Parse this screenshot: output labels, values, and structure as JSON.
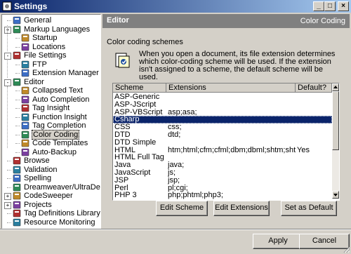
{
  "window": {
    "title": "Settings",
    "controls": [
      "minimize",
      "maximize",
      "close"
    ]
  },
  "tree": {
    "items": [
      {
        "label": "General",
        "icon": "general-icon",
        "expander": ""
      },
      {
        "label": "Markup Languages",
        "icon": "markup-icon",
        "expander": "+"
      },
      {
        "label": "Startup",
        "icon": "folder-icon",
        "expander": ""
      },
      {
        "label": "Locations",
        "icon": "locations-icon",
        "expander": ""
      },
      {
        "label": "File Settings",
        "icon": "file-settings-icon",
        "expander": "-"
      },
      {
        "label": "FTP",
        "icon": "ftp-icon",
        "expander": ""
      },
      {
        "label": "Extension Manager",
        "icon": "extension-manager-icon",
        "expander": ""
      },
      {
        "label": "Editor",
        "icon": "editor-icon",
        "expander": "-"
      },
      {
        "label": "Collapsed Text",
        "icon": "collapsed-text-icon",
        "expander": ""
      },
      {
        "label": "Auto Completion",
        "icon": "auto-completion-icon",
        "expander": ""
      },
      {
        "label": "Tag Insight",
        "icon": "tag-insight-icon",
        "expander": ""
      },
      {
        "label": "Function Insight",
        "icon": "function-insight-icon",
        "expander": ""
      },
      {
        "label": "Tag Completion",
        "icon": "tag-completion-icon",
        "expander": ""
      },
      {
        "label": "Color Coding",
        "icon": "color-coding-icon",
        "expander": ""
      },
      {
        "label": "Code Templates",
        "icon": "code-templates-icon",
        "expander": ""
      },
      {
        "label": "Auto-Backup",
        "icon": "auto-backup-icon",
        "expander": ""
      },
      {
        "label": "Browse",
        "icon": "browse-icon",
        "expander": ""
      },
      {
        "label": "Validation",
        "icon": "validation-icon",
        "expander": ""
      },
      {
        "label": "Spelling",
        "icon": "spelling-icon",
        "expander": ""
      },
      {
        "label": "Dreamweaver/UltraDev",
        "icon": "dreamweaver-icon",
        "expander": ""
      },
      {
        "label": "CodeSweeper",
        "icon": "codesweeper-icon",
        "expander": "+"
      },
      {
        "label": "Projects",
        "icon": "projects-icon",
        "expander": "+"
      },
      {
        "label": "Tag Definitions Library",
        "icon": "tag-definitions-icon",
        "expander": ""
      },
      {
        "label": "Resource Monitoring",
        "icon": "resource-monitoring-icon",
        "expander": ""
      }
    ],
    "selected": "Color Coding"
  },
  "panel": {
    "title": "Editor",
    "breadcrumb": "Color Coding",
    "section_label": "Color coding schemes",
    "info_text": "When you open a document, its file extension determines which color-coding scheme will be used.  If the extension isn't assigned to a scheme, the default scheme will be used.",
    "grid": {
      "columns": [
        "Scheme",
        "Extensions",
        "Default?"
      ],
      "rows": [
        {
          "scheme": "ASP-Generic",
          "extensions": "",
          "default": ""
        },
        {
          "scheme": "ASP-JScript",
          "extensions": "",
          "default": ""
        },
        {
          "scheme": "ASP-VBScript",
          "extensions": "asp;asa;",
          "default": ""
        },
        {
          "scheme": "Csharp",
          "extensions": "",
          "default": ""
        },
        {
          "scheme": "CSS",
          "extensions": "css;",
          "default": ""
        },
        {
          "scheme": "DTD",
          "extensions": "dtd;",
          "default": ""
        },
        {
          "scheme": "DTD Simple",
          "extensions": "",
          "default": ""
        },
        {
          "scheme": "HTML",
          "extensions": "htm;html;cfm;cfml;dbm;dbml;shtm;shtml;wml;",
          "default": "Yes"
        },
        {
          "scheme": "HTML Full Tag",
          "extensions": "",
          "default": ""
        },
        {
          "scheme": "Java",
          "extensions": "java;",
          "default": ""
        },
        {
          "scheme": "JavaScript",
          "extensions": "js;",
          "default": ""
        },
        {
          "scheme": "JSP",
          "extensions": "jsp;",
          "default": ""
        },
        {
          "scheme": "Perl",
          "extensions": "pl;cgi;",
          "default": ""
        },
        {
          "scheme": "PHP 3",
          "extensions": "php;phtml;php3;",
          "default": ""
        }
      ],
      "selected_scheme": "Csharp"
    },
    "buttons": {
      "edit_scheme": "Edit Scheme",
      "edit_extensions": "Edit Extensions",
      "set_default": "Set as Default"
    }
  },
  "footer": {
    "apply": "Apply",
    "cancel": "Cancel"
  },
  "colors": {
    "selection": "#0a246a",
    "titlebar": "#0a246a",
    "face": "#d4d0c8",
    "panel_header": "#808080"
  }
}
